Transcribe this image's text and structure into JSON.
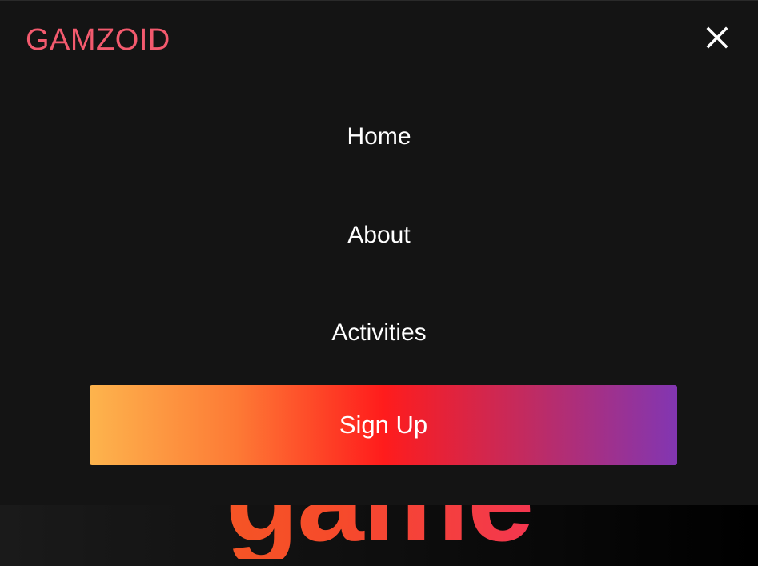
{
  "brand": {
    "name": "GAMZOID",
    "color": "#f35a6e"
  },
  "menu": {
    "close_icon": "close-icon",
    "items": [
      {
        "label": "Home"
      },
      {
        "label": "About"
      },
      {
        "label": "Activities"
      }
    ],
    "cta_label": "Sign Up",
    "cta_gradient": [
      "#fdb44d",
      "#ff1c1c",
      "#8236b2"
    ],
    "background": "#141414"
  },
  "hero": {
    "word": "game"
  }
}
